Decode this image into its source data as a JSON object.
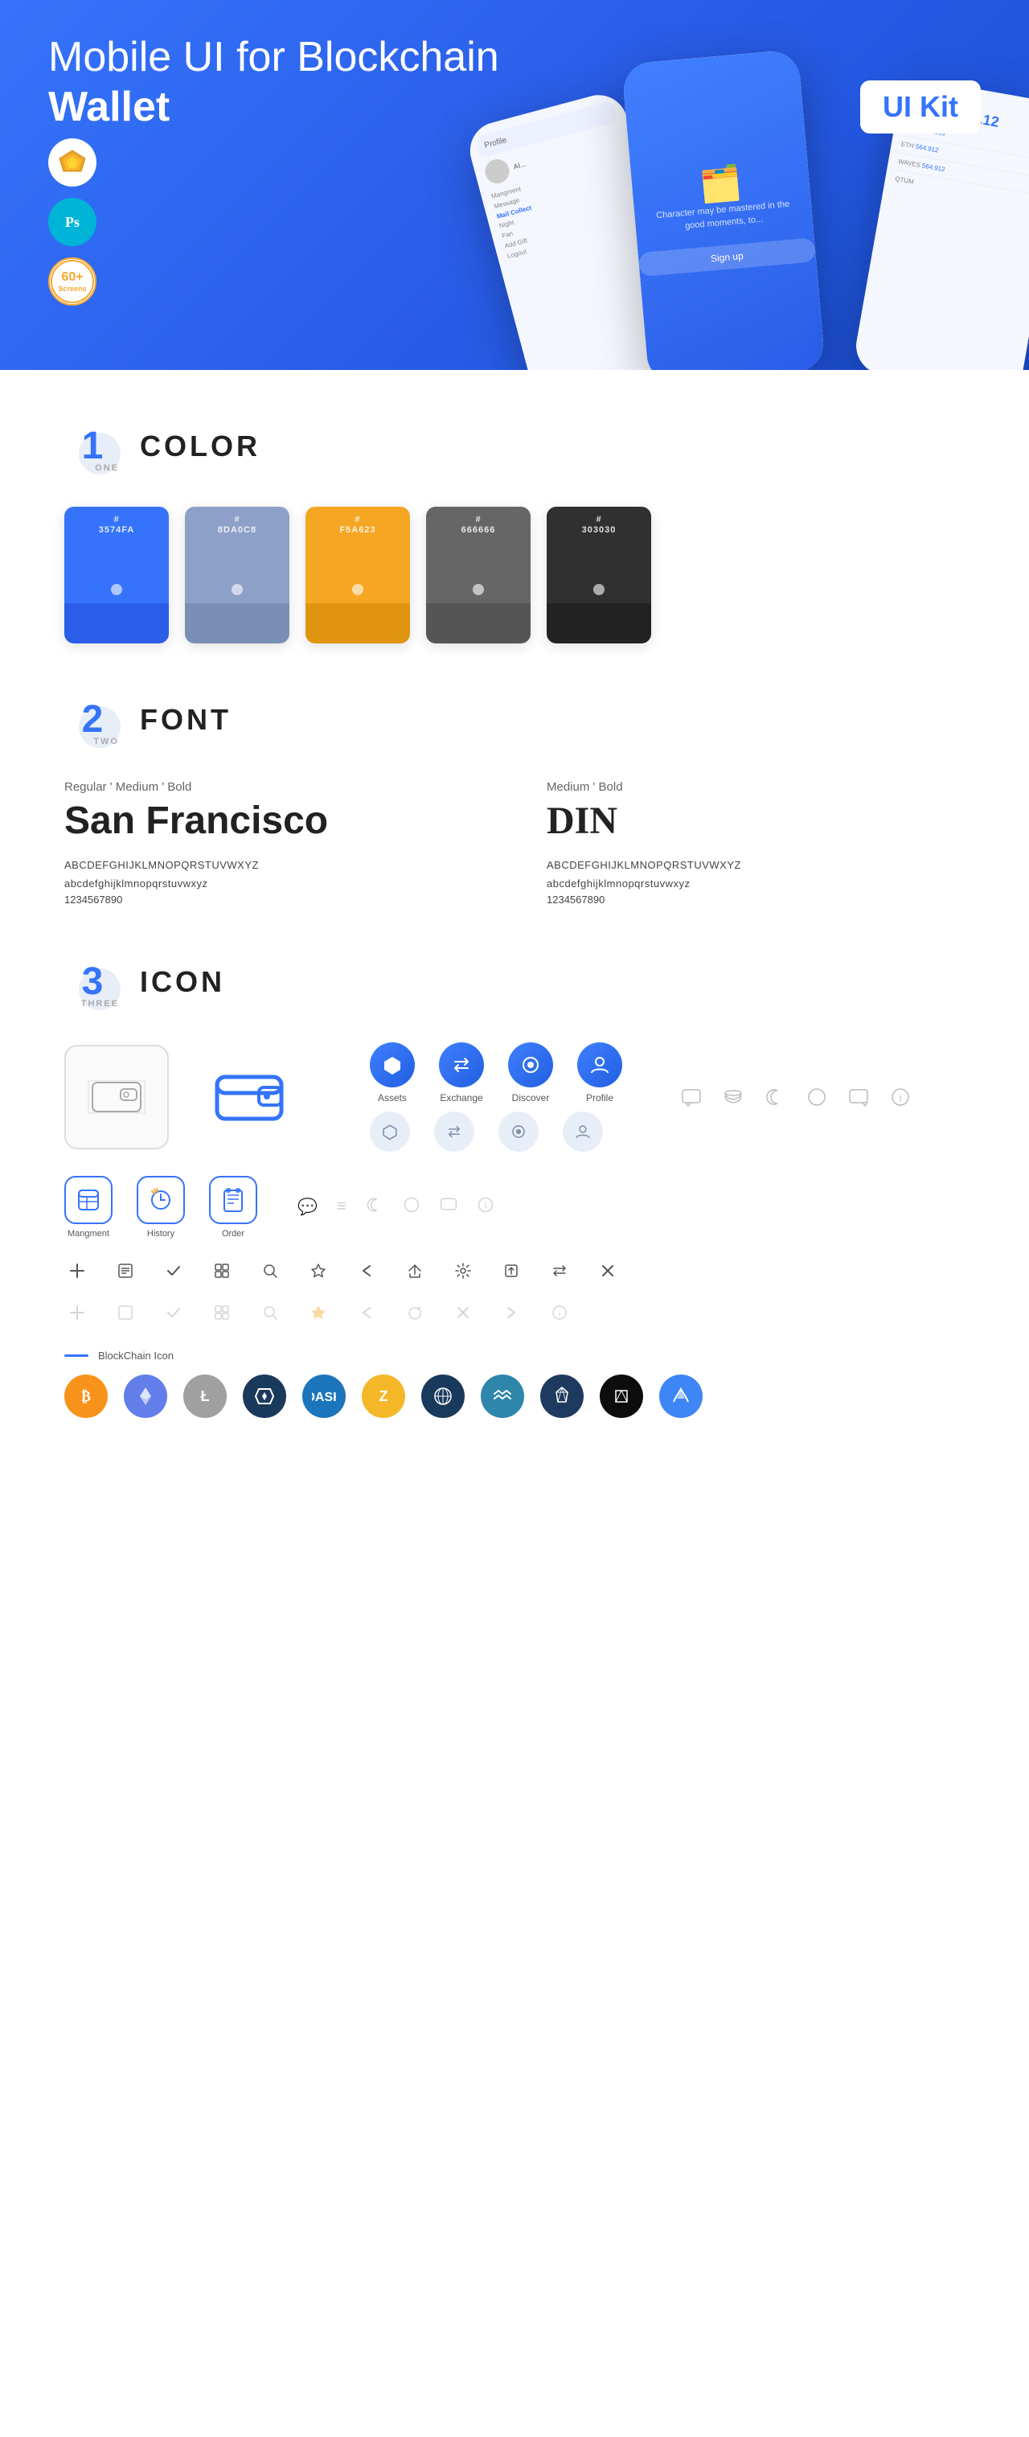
{
  "hero": {
    "title_regular": "Mobile UI for Blockchain ",
    "title_bold": "Wallet",
    "badge": "UI Kit",
    "badges": [
      {
        "type": "sketch",
        "label": "Sketch"
      },
      {
        "type": "ps",
        "label": "Ps"
      },
      {
        "type": "screens",
        "line1": "60+",
        "line2": "Screens"
      }
    ]
  },
  "sections": {
    "color": {
      "number": "1",
      "sub": "ONE",
      "title": "COLOR",
      "swatches": [
        {
          "hex": "#3574FA",
          "label": "#\n3574FA"
        },
        {
          "hex": "#8DA0C8",
          "label": "#\n8DA0C8"
        },
        {
          "hex": "#F5A623",
          "label": "#\nF5A623"
        },
        {
          "hex": "#666666",
          "label": "#\n666666"
        },
        {
          "hex": "#303030",
          "label": "#\n303030"
        }
      ]
    },
    "font": {
      "number": "2",
      "sub": "TWO",
      "title": "FONT",
      "fonts": [
        {
          "meta": "Regular ' Medium ' Bold",
          "name": "San Francisco",
          "upper": "ABCDEFGHIJKLMNOPQRSTUVWXYZ",
          "lower": "abcdefghijklmnopqrstuvwxyz",
          "nums": "1234567890"
        },
        {
          "meta": "Medium ' Bold",
          "name": "DIN",
          "upper": "ABCDEFGHIJKLMNOPQRSTUVWXYZ",
          "lower": "abcdefghijklmnopqrstuvwxyz",
          "nums": "1234567890"
        }
      ]
    },
    "icon": {
      "number": "3",
      "sub": "THREE",
      "title": "ICON",
      "nav_icons": [
        {
          "label": "Assets",
          "icon": "◆"
        },
        {
          "label": "Exchange",
          "icon": "⇄"
        },
        {
          "label": "Discover",
          "icon": "●"
        },
        {
          "label": "Profile",
          "icon": "◑"
        }
      ],
      "app_icons": [
        {
          "label": "Mangment",
          "icon": "▤"
        },
        {
          "label": "History",
          "icon": "⏱"
        },
        {
          "label": "Order",
          "icon": "📋"
        }
      ],
      "small_icons": [
        "＋",
        "⊞",
        "✓",
        "⊟",
        "🔍",
        "☆",
        "‹",
        "≪",
        "⚙",
        "⊡",
        "⇆",
        "✕"
      ],
      "blockchain_label": "BlockChain Icon",
      "crypto_coins": [
        {
          "color": "#F7931A",
          "symbol": "₿"
        },
        {
          "color": "#627EEA",
          "symbol": "Ξ"
        },
        {
          "color": "#9B59B6",
          "symbol": "Ł"
        },
        {
          "color": "#1A3A5C",
          "symbol": "◆"
        },
        {
          "color": "#1B75BC",
          "symbol": "Ð"
        },
        {
          "color": "#7F5AF0",
          "symbol": "Z"
        },
        {
          "color": "#1A3A5C",
          "symbol": "⬡"
        },
        {
          "color": "#2E86AB",
          "symbol": "▲"
        },
        {
          "color": "#1E3A5F",
          "symbol": "◈"
        },
        {
          "color": "#F7931A",
          "symbol": "∞"
        },
        {
          "color": "#3E86F5",
          "symbol": "~"
        }
      ]
    }
  }
}
